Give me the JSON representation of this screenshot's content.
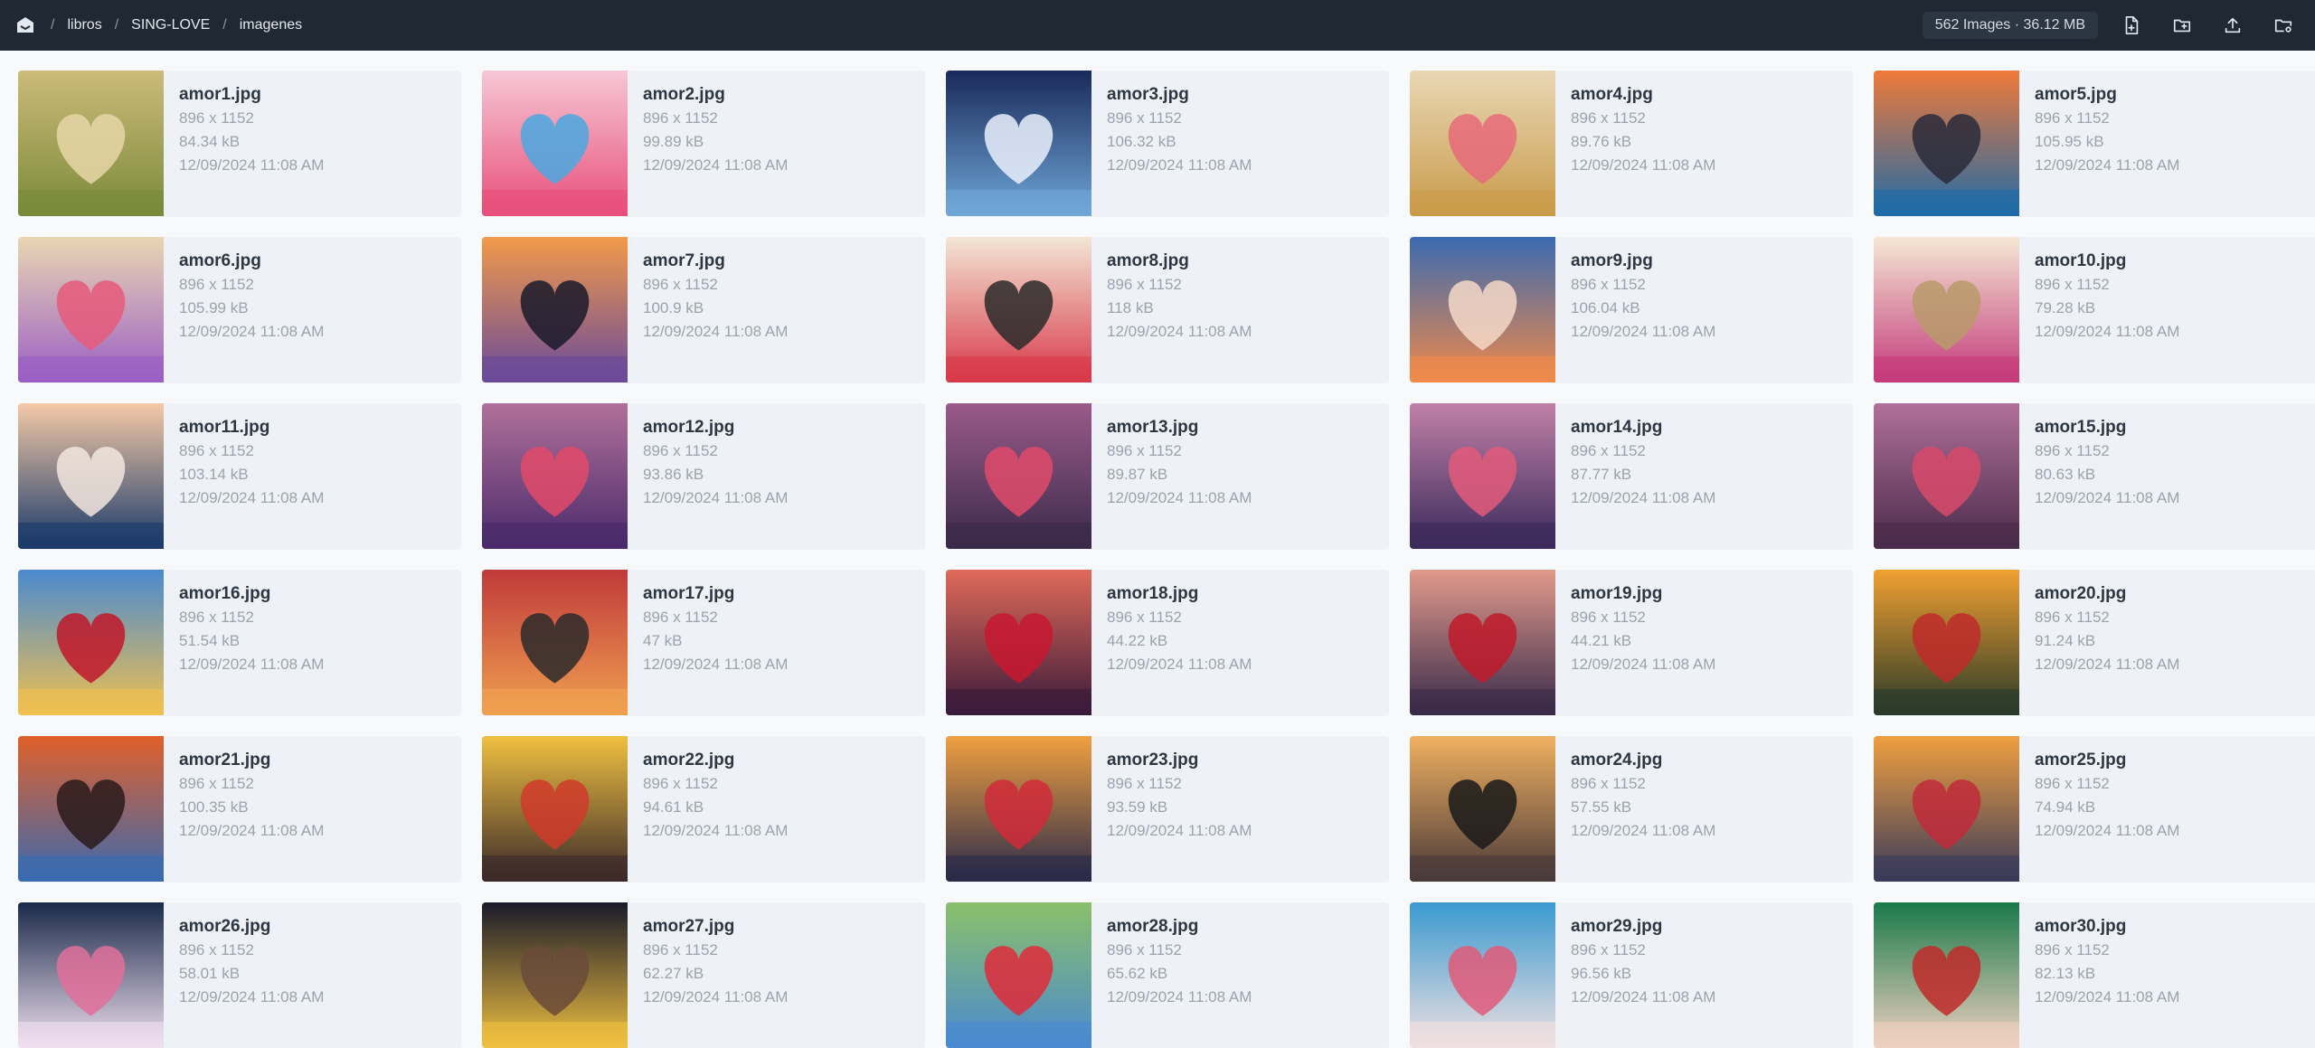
{
  "breadcrumb": {
    "items": [
      "libros",
      "SING-LOVE",
      "imagenes"
    ]
  },
  "summary": "562 Images · 36.12 MB",
  "toolbar": {
    "icons": [
      "new-file-icon",
      "new-folder-icon",
      "upload-icon",
      "folder-settings-icon"
    ]
  },
  "colors": {
    "topbar": "#1f2833",
    "card": "#eef1f5",
    "background": "#f8f9fb"
  },
  "files": [
    {
      "name": "amor1.jpg",
      "dims": "896 x 1152",
      "size": "84.34 kB",
      "date": "12/09/2024 11:08 AM",
      "palette": [
        "#cdbb7a",
        "#7a8a3a",
        "#e8d6a8"
      ]
    },
    {
      "name": "amor2.jpg",
      "dims": "896 x 1152",
      "size": "99.89 kB",
      "date": "12/09/2024 11:08 AM",
      "palette": [
        "#f6c7d6",
        "#e84f7a",
        "#4aa8e0"
      ]
    },
    {
      "name": "amor3.jpg",
      "dims": "896 x 1152",
      "size": "106.32 kB",
      "date": "12/09/2024 11:08 AM",
      "palette": [
        "#1a2a5a",
        "#6fa7d8",
        "#e9f0fb"
      ]
    },
    {
      "name": "amor4.jpg",
      "dims": "896 x 1152",
      "size": "89.76 kB",
      "date": "12/09/2024 11:08 AM",
      "palette": [
        "#e9d7b5",
        "#c99b4a",
        "#e66a7a"
      ]
    },
    {
      "name": "amor5.jpg",
      "dims": "896 x 1152",
      "size": "105.95 kB",
      "date": "12/09/2024 11:08 AM",
      "palette": [
        "#f07a3a",
        "#1e6aa8",
        "#2a2a3a"
      ]
    },
    {
      "name": "amor6.jpg",
      "dims": "896 x 1152",
      "size": "105.99 kB",
      "date": "12/09/2024 11:08 AM",
      "palette": [
        "#e9d6b3",
        "#9b5fc4",
        "#e65a7a"
      ]
    },
    {
      "name": "amor7.jpg",
      "dims": "896 x 1152",
      "size": "100.9 kB",
      "date": "12/09/2024 11:08 AM",
      "palette": [
        "#f29a4a",
        "#6a4a9a",
        "#1a1a2a"
      ]
    },
    {
      "name": "amor8.jpg",
      "dims": "896 x 1152",
      "size": "118 kB",
      "date": "12/09/2024 11:08 AM",
      "palette": [
        "#f3e6d4",
        "#d8384a",
        "#2a2a2a"
      ]
    },
    {
      "name": "amor9.jpg",
      "dims": "896 x 1152",
      "size": "106.04 kB",
      "date": "12/09/2024 11:08 AM",
      "palette": [
        "#3a6ab0",
        "#f08a4a",
        "#f4d8c8"
      ]
    },
    {
      "name": "amor10.jpg",
      "dims": "896 x 1152",
      "size": "79.28 kB",
      "date": "12/09/2024 11:08 AM",
      "palette": [
        "#f4e8d4",
        "#c43a7a",
        "#b89a6a"
      ]
    },
    {
      "name": "amor11.jpg",
      "dims": "896 x 1152",
      "size": "103.14 kB",
      "date": "12/09/2024 11:08 AM",
      "palette": [
        "#f5c9a6",
        "#1a3a6a",
        "#f2e6de"
      ]
    },
    {
      "name": "amor12.jpg",
      "dims": "896 x 1152",
      "size": "93.86 kB",
      "date": "12/09/2024 11:08 AM",
      "palette": [
        "#b0709a",
        "#4a2a6a",
        "#e24a6a"
      ]
    },
    {
      "name": "amor13.jpg",
      "dims": "896 x 1152",
      "size": "89.87 kB",
      "date": "12/09/2024 11:08 AM",
      "palette": [
        "#9a5a8a",
        "#3a2a4a",
        "#e04a6a"
      ]
    },
    {
      "name": "amor14.jpg",
      "dims": "896 x 1152",
      "size": "87.77 kB",
      "date": "12/09/2024 11:08 AM",
      "palette": [
        "#c080a8",
        "#3a2a5a",
        "#e25a7a"
      ]
    },
    {
      "name": "amor15.jpg",
      "dims": "896 x 1152",
      "size": "80.63 kB",
      "date": "12/09/2024 11:08 AM",
      "palette": [
        "#b0709a",
        "#4a2a4a",
        "#d84a6a"
      ]
    },
    {
      "name": "amor16.jpg",
      "dims": "896 x 1152",
      "size": "51.54 kB",
      "date": "12/09/2024 11:08 AM",
      "palette": [
        "#4a8ad0",
        "#f0c050",
        "#c0182a"
      ]
    },
    {
      "name": "amor17.jpg",
      "dims": "896 x 1152",
      "size": "47 kB",
      "date": "12/09/2024 11:08 AM",
      "palette": [
        "#c03a3a",
        "#f0a050",
        "#2a2a2a"
      ]
    },
    {
      "name": "amor18.jpg",
      "dims": "896 x 1152",
      "size": "44.22 kB",
      "date": "12/09/2024 11:08 AM",
      "palette": [
        "#e06a5a",
        "#3a1a3a",
        "#c81830"
      ]
    },
    {
      "name": "amor19.jpg",
      "dims": "896 x 1152",
      "size": "44.21 kB",
      "date": "12/09/2024 11:08 AM",
      "palette": [
        "#e09a8a",
        "#3a2a4a",
        "#c01a2a"
      ]
    },
    {
      "name": "amor20.jpg",
      "dims": "896 x 1152",
      "size": "91.24 kB",
      "date": "12/09/2024 11:08 AM",
      "palette": [
        "#f0a030",
        "#2a3a2a",
        "#c02a2a"
      ]
    },
    {
      "name": "amor21.jpg",
      "dims": "896 x 1152",
      "size": "100.35 kB",
      "date": "12/09/2024 11:08 AM",
      "palette": [
        "#e0602a",
        "#3a6ab0",
        "#2a1a1a"
      ]
    },
    {
      "name": "amor22.jpg",
      "dims": "896 x 1152",
      "size": "94.61 kB",
      "date": "12/09/2024 11:08 AM",
      "palette": [
        "#f0c040",
        "#3a2a2a",
        "#d03a2a"
      ]
    },
    {
      "name": "amor23.jpg",
      "dims": "896 x 1152",
      "size": "93.59 kB",
      "date": "12/09/2024 11:08 AM",
      "palette": [
        "#f0a040",
        "#2a2a4a",
        "#d02a3a"
      ]
    },
    {
      "name": "amor24.jpg",
      "dims": "896 x 1152",
      "size": "57.55 kB",
      "date": "12/09/2024 11:08 AM",
      "palette": [
        "#f0b060",
        "#4a3a3a",
        "#1a1a1a"
      ]
    },
    {
      "name": "amor25.jpg",
      "dims": "896 x 1152",
      "size": "74.94 kB",
      "date": "12/09/2024 11:08 AM",
      "palette": [
        "#f0a040",
        "#3a3a5a",
        "#c02a3a"
      ]
    },
    {
      "name": "amor26.jpg",
      "dims": "896 x 1152",
      "size": "58.01 kB",
      "date": "12/09/2024 11:08 AM",
      "palette": [
        "#1a2a4a",
        "#f0e0f0",
        "#e0709a"
      ]
    },
    {
      "name": "amor27.jpg",
      "dims": "896 x 1152",
      "size": "62.27 kB",
      "date": "12/09/2024 11:08 AM",
      "palette": [
        "#1a1a2a",
        "#f0c040",
        "#6a4a3a"
      ]
    },
    {
      "name": "amor28.jpg",
      "dims": "896 x 1152",
      "size": "65.62 kB",
      "date": "12/09/2024 11:08 AM",
      "palette": [
        "#8ac06a",
        "#4a8ad0",
        "#e02a3a"
      ]
    },
    {
      "name": "amor29.jpg",
      "dims": "896 x 1152",
      "size": "96.56 kB",
      "date": "12/09/2024 11:08 AM",
      "palette": [
        "#3a9ad0",
        "#f0e0e0",
        "#e05a7a"
      ]
    },
    {
      "name": "amor30.jpg",
      "dims": "896 x 1152",
      "size": "82.13 kB",
      "date": "12/09/2024 11:08 AM",
      "palette": [
        "#1a7a4a",
        "#f0d0c0",
        "#c02a2a"
      ]
    }
  ]
}
